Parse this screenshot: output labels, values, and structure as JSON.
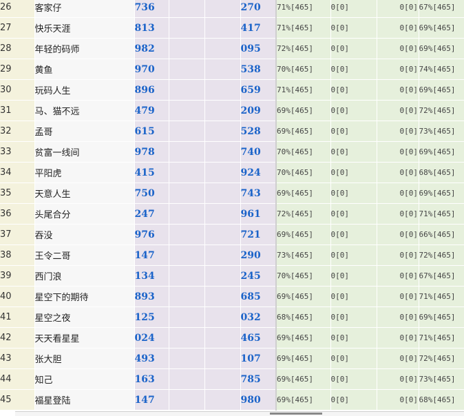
{
  "rows": [
    {
      "rank": "26",
      "name": "客家仔",
      "num1": "736",
      "num2": "270",
      "p1": "71%[465]",
      "z1": "0[0]",
      "z2": "0[0]",
      "p2": "67%[465]"
    },
    {
      "rank": "27",
      "name": "快乐天涯",
      "num1": "813",
      "num2": "417",
      "p1": "71%[465]",
      "z1": "0[0]",
      "z2": "0[0]",
      "p2": "69%[465]"
    },
    {
      "rank": "28",
      "name": "年轻的码师",
      "num1": "982",
      "num2": "095",
      "p1": "72%[465]",
      "z1": "0[0]",
      "z2": "0[0]",
      "p2": "69%[465]"
    },
    {
      "rank": "29",
      "name": "黄鱼",
      "num1": "970",
      "num2": "538",
      "p1": "70%[465]",
      "z1": "0[0]",
      "z2": "0[0]",
      "p2": "74%[465]"
    },
    {
      "rank": "30",
      "name": "玩码人生",
      "num1": "896",
      "num2": "659",
      "p1": "71%[465]",
      "z1": "0[0]",
      "z2": "0[0]",
      "p2": "69%[465]"
    },
    {
      "rank": "31",
      "name": "马、猫不远",
      "num1": "479",
      "num2": "209",
      "p1": "69%[465]",
      "z1": "0[0]",
      "z2": "0[0]",
      "p2": "72%[465]"
    },
    {
      "rank": "32",
      "name": "孟哥",
      "num1": "615",
      "num2": "528",
      "p1": "69%[465]",
      "z1": "0[0]",
      "z2": "0[0]",
      "p2": "73%[465]"
    },
    {
      "rank": "33",
      "name": "贫富一线间",
      "num1": "978",
      "num2": "740",
      "p1": "70%[465]",
      "z1": "0[0]",
      "z2": "0[0]",
      "p2": "69%[465]"
    },
    {
      "rank": "34",
      "name": "平阳虎",
      "num1": "415",
      "num2": "924",
      "p1": "70%[465]",
      "z1": "0[0]",
      "z2": "0[0]",
      "p2": "68%[465]"
    },
    {
      "rank": "35",
      "name": "天意人生",
      "num1": "750",
      "num2": "743",
      "p1": "69%[465]",
      "z1": "0[0]",
      "z2": "0[0]",
      "p2": "69%[465]"
    },
    {
      "rank": "36",
      "name": "头尾合分",
      "num1": "247",
      "num2": "961",
      "p1": "72%[465]",
      "z1": "0[0]",
      "z2": "0[0]",
      "p2": "71%[465]"
    },
    {
      "rank": "37",
      "name": "吞没",
      "num1": "976",
      "num2": "721",
      "p1": "69%[465]",
      "z1": "0[0]",
      "z2": "0[0]",
      "p2": "66%[465]"
    },
    {
      "rank": "38",
      "name": "王令二哥",
      "num1": "147",
      "num2": "290",
      "p1": "73%[465]",
      "z1": "0[0]",
      "z2": "0[0]",
      "p2": "72%[465]"
    },
    {
      "rank": "39",
      "name": "西门浪",
      "num1": "134",
      "num2": "245",
      "p1": "70%[465]",
      "z1": "0[0]",
      "z2": "0[0]",
      "p2": "67%[465]"
    },
    {
      "rank": "40",
      "name": "星空下的期待",
      "num1": "893",
      "num2": "685",
      "p1": "69%[465]",
      "z1": "0[0]",
      "z2": "0[0]",
      "p2": "71%[465]"
    },
    {
      "rank": "41",
      "name": "星空之夜",
      "num1": "125",
      "num2": "032",
      "p1": "68%[465]",
      "z1": "0[0]",
      "z2": "0[0]",
      "p2": "69%[465]"
    },
    {
      "rank": "42",
      "name": "天天看星星",
      "num1": "024",
      "num2": "465",
      "p1": "69%[465]",
      "z1": "0[0]",
      "z2": "0[0]",
      "p2": "71%[465]"
    },
    {
      "rank": "43",
      "name": "张大胆",
      "num1": "493",
      "num2": "107",
      "p1": "69%[465]",
      "z1": "0[0]",
      "z2": "0[0]",
      "p2": "72%[465]"
    },
    {
      "rank": "44",
      "name": "知己",
      "num1": "163",
      "num2": "785",
      "p1": "69%[465]",
      "z1": "0[0]",
      "z2": "0[0]",
      "p2": "73%[465]"
    },
    {
      "rank": "45",
      "name": "福星登陆",
      "num1": "147",
      "num2": "980",
      "p1": "69%[465]",
      "z1": "0[0]",
      "z2": "0[0]",
      "p2": "68%[465]"
    }
  ]
}
